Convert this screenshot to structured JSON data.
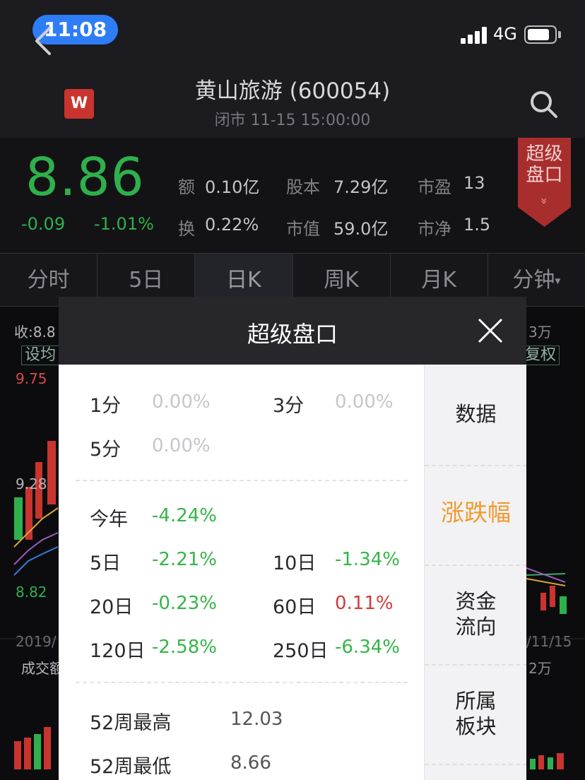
{
  "status": {
    "time": "11:08",
    "network": "4G"
  },
  "header": {
    "title": "黄山旅游 (600054)",
    "subtitle": "闭市 11-15 15:00:00",
    "logo_letter": "W"
  },
  "quote": {
    "price": "8.86",
    "change": "-0.09",
    "change_pct": "-1.01%",
    "stats": {
      "turnover_amount": {
        "label": "额",
        "value": "0.10亿"
      },
      "share_capital": {
        "label": "股本",
        "value": "7.29亿"
      },
      "pe": {
        "label": "市盈",
        "value": "13"
      },
      "turnover_rate": {
        "label": "换",
        "value": "0.22%"
      },
      "market_cap": {
        "label": "市值",
        "value": "59.0亿"
      },
      "pb": {
        "label": "市净",
        "value": "1.5"
      }
    },
    "super_tag": {
      "line1": "超级",
      "line2": "盘口",
      "chevron": "»"
    }
  },
  "tabs": [
    "分时",
    "5日",
    "日K",
    "周K",
    "月K",
    "分钟"
  ],
  "tabs_dropdown_glyph": "▾",
  "chart_bg": {
    "close_label": "收:8.8",
    "right_volume": "3万",
    "ma_button": "设均",
    "fq_button": "复权",
    "y_high": "9.75",
    "y_mid": "9.28",
    "y_low": "8.82",
    "date_left": "2019/",
    "date_right": "/11/15",
    "volume_label": "成交额",
    "volume_right": "2万"
  },
  "modal": {
    "title": "超级盘口",
    "minutes": [
      {
        "label": "1分",
        "value": "0.00%"
      },
      {
        "label": "3分",
        "value": "0.00%"
      },
      {
        "label": "5分",
        "value": "0.00%"
      }
    ],
    "periods": {
      "ytd": {
        "label": "今年",
        "value": "-4.24%"
      },
      "d5": {
        "label": "5日",
        "value": "-2.21%"
      },
      "d10": {
        "label": "10日",
        "value": "-1.34%"
      },
      "d20": {
        "label": "20日",
        "value": "-0.23%"
      },
      "d60": {
        "label": "60日",
        "value": "0.11%"
      },
      "d120": {
        "label": "120日",
        "value": "-2.58%"
      },
      "d250": {
        "label": "250日",
        "value": "-6.34%"
      }
    },
    "week52": {
      "high": {
        "label": "52周最高",
        "value": "12.03"
      },
      "low": {
        "label": "52周最低",
        "value": "8.66"
      }
    },
    "menu": {
      "data": "数据",
      "change": "涨跌幅",
      "fund_line1": "资金",
      "fund_line2": "流向",
      "sector_line1": "所属",
      "sector_line2": "板块"
    }
  },
  "colors": {
    "up": "#d63a3a",
    "down": "#35b548",
    "accent": "#f09a2e",
    "pill": "#2f7df6"
  }
}
